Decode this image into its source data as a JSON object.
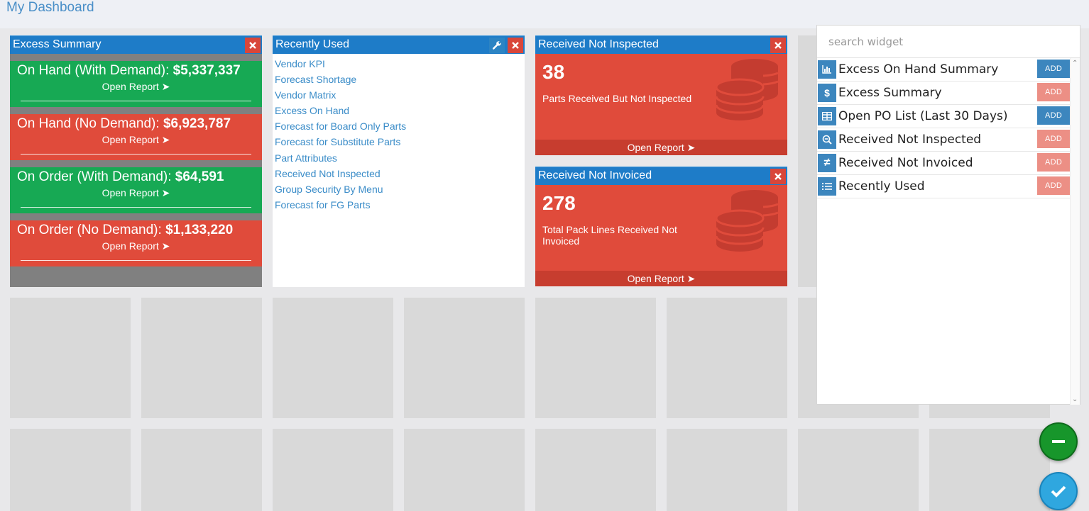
{
  "page": {
    "title": "My Dashboard"
  },
  "excess_summary": {
    "title": "Excess Summary",
    "tiles": [
      {
        "label": "On Hand (With Demand):",
        "value": "$5,337,337",
        "link": "Open Report",
        "status": "green"
      },
      {
        "label": "On Hand (No Demand):",
        "value": "$6,923,787",
        "link": "Open Report",
        "status": "red"
      },
      {
        "label": "On Order (With Demand):",
        "value": "$64,591",
        "link": "Open Report",
        "status": "green"
      },
      {
        "label": "On Order (No Demand):",
        "value": "$1,133,220",
        "link": "Open Report",
        "status": "red"
      }
    ]
  },
  "recently_used": {
    "title": "Recently Used",
    "links": [
      "Vendor KPI",
      "Forecast Shortage",
      "Vendor Matrix",
      "Excess On Hand",
      "Forecast for Board Only Parts",
      "Forecast for Substitute Parts",
      "Part Attributes",
      "Received Not Inspected",
      "Group Security By Menu",
      "Forecast for FG Parts"
    ]
  },
  "received_not_inspected": {
    "title": "Received Not Inspected",
    "count": "38",
    "label": "Parts Received But Not Inspected",
    "link": "Open Report"
  },
  "received_not_invoiced": {
    "title": "Received Not Invoiced",
    "count": "278",
    "label": "Total Pack Lines Received Not Invoiced",
    "link": "Open Report"
  },
  "widget_panel": {
    "search_placeholder": "search widget",
    "widgets": [
      {
        "name": "Excess On Hand Summary",
        "icon": "bar-chart-icon",
        "button": "ADD",
        "enabled": true
      },
      {
        "name": "Excess Summary",
        "icon": "dollar-icon",
        "button": "ADD",
        "enabled": false
      },
      {
        "name": "Open PO List (Last 30 Days)",
        "icon": "table-icon",
        "button": "ADD",
        "enabled": true
      },
      {
        "name": "Received Not Inspected",
        "icon": "zoom-out-icon",
        "button": "ADD",
        "enabled": false
      },
      {
        "name": "Received Not Invoiced",
        "icon": "not-equal-icon",
        "button": "ADD",
        "enabled": false
      },
      {
        "name": "Recently Used",
        "icon": "list-icon",
        "button": "ADD",
        "enabled": false
      }
    ]
  },
  "colors": {
    "header_blue": "#1e7cc8",
    "green": "#17a954",
    "red": "#e04b3b",
    "link_blue": "#3a8cc8",
    "add_blue": "#3c86be",
    "add_disabled": "#ec8f85"
  }
}
